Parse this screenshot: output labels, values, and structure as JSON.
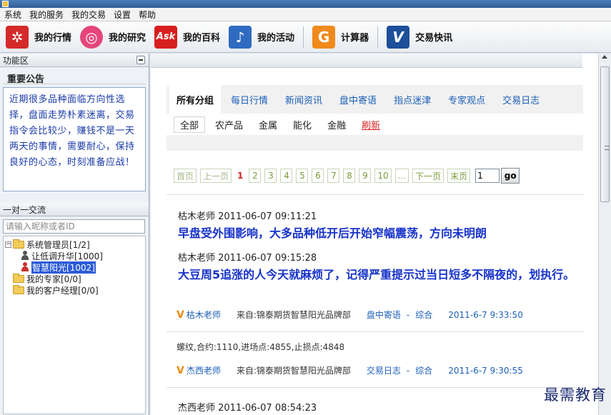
{
  "menubar": [
    "系统",
    "我的服务",
    "我的交易",
    "设置",
    "帮助"
  ],
  "toolbar": [
    {
      "label": "我的行情",
      "icon": "market-icon",
      "color": "#d42a2a",
      "glyph": "✲"
    },
    {
      "label": "我的研究",
      "icon": "basketball-icon",
      "color": "#e5457a",
      "glyph": "◎"
    },
    {
      "label": "我的百科",
      "icon": "ask-icon",
      "color": "#d81f1f",
      "glyph": "Ask"
    },
    {
      "label": "我的活动",
      "icon": "music-note-icon",
      "color": "#2f6bc0",
      "glyph": "♪"
    },
    {
      "label": "计算器",
      "icon": "calculator-icon",
      "color": "#f08a1c",
      "glyph": "G"
    },
    {
      "label": "交易快讯",
      "icon": "vimeo-icon",
      "color": "#1d4f9a",
      "glyph": "V"
    }
  ],
  "left": {
    "panel_title": "功能区",
    "notice_title": "重要公告",
    "notice_text": "近期很多品种面临方向性选择，盘面走势朴素迷离，交易指令会比较少，赚钱不是一天两天的事情，需要耐心，保持良好的心态，时刻准备应战！",
    "chat_title": "一对一交流",
    "search_placeholder": "请输入昵称或者ID",
    "tree": {
      "group1": "系统管理员[1/2]",
      "user1": "让低调升华[1000]",
      "user2": "智慧阳光[1002]",
      "group2": "我的专家[0/0]",
      "group3": "我的客户经理[0/0]"
    }
  },
  "filters": {
    "tabs": [
      "所有分组",
      "每日行情",
      "新闻资讯",
      "盘中寄语",
      "指点迷津",
      "专家观点",
      "交易日志"
    ],
    "subtabs": [
      "全部",
      "农产品",
      "金属",
      "能化",
      "金融"
    ],
    "refresh": "刷新"
  },
  "pager": {
    "first": "首页",
    "prev": "上一页",
    "current": "1",
    "pages": [
      "2",
      "3",
      "4",
      "5",
      "6",
      "7",
      "8",
      "9",
      "10"
    ],
    "ellipsis": "...",
    "next": "下一页",
    "last": "末页",
    "input_value": "1",
    "go": "go"
  },
  "posts": [
    {
      "messages": [
        {
          "meta": "枯木老师  2011-06-07 09:11:21",
          "text": "早盘受外围影响，大多品种低开后开始窄幅震荡，方向未明朗"
        },
        {
          "meta": "枯木老师  2011-06-07 09:15:28",
          "text": "大豆周5追涨的人今天就麻烦了，记得严重提示过当日短多不隔夜的，划执行。"
        }
      ],
      "footer": {
        "v": "V",
        "author": "枯木老师",
        "source": "来自:锦泰期货智慧阳光品牌部",
        "category": "盘中寄语",
        "dash": "-",
        "sub": "综合",
        "time": "2011-6-7 9:33:50"
      }
    },
    {
      "line": "螺纹,合约:1110,进场点:4855,止损点:4848",
      "footer": {
        "v": "V",
        "author": "杰西老师",
        "source": "来自:锦泰期货智慧阳光品牌部",
        "category": "交易日志",
        "dash": "-",
        "sub": "综合",
        "time": "2011-6-7 9:30:55"
      }
    },
    {
      "meta": "杰西老师  2011-06-07 08:54:23"
    }
  ],
  "watermark": "最需教育"
}
